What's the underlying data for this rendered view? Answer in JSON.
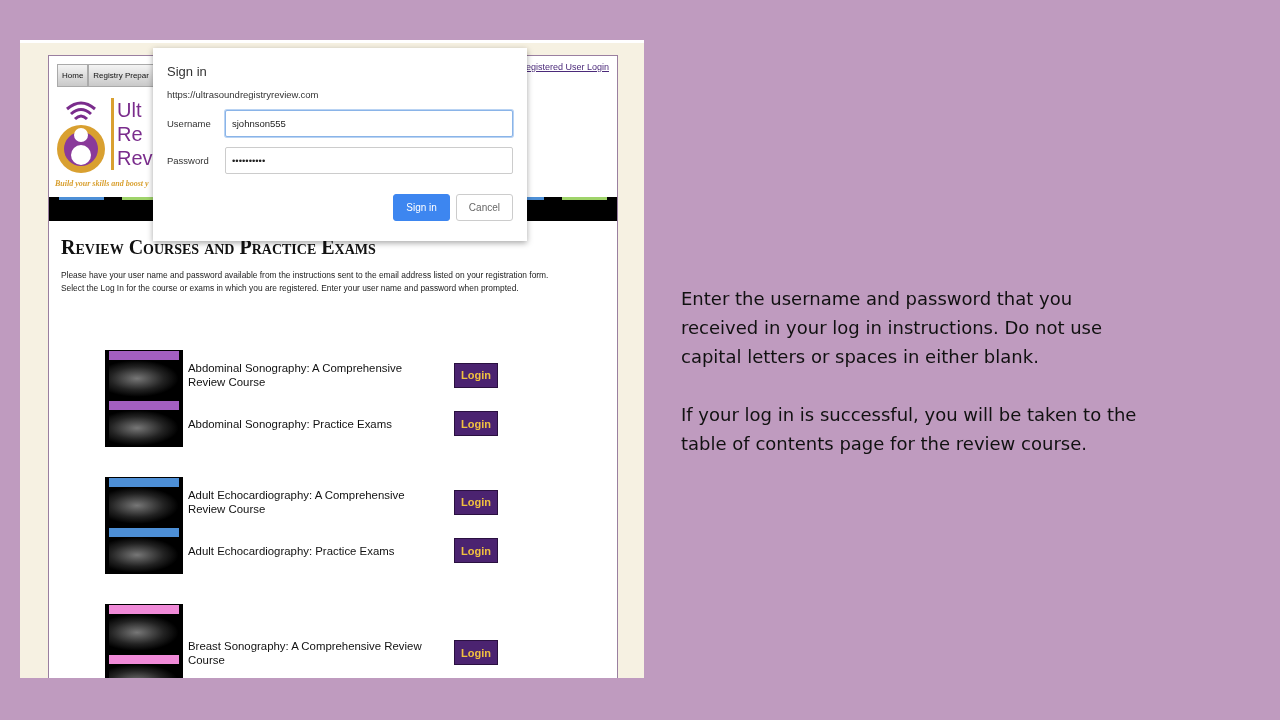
{
  "browser_page": {
    "nav": [
      {
        "label": "Home"
      },
      {
        "label": "Registry Prepar"
      }
    ],
    "top_link": "egistered User Login",
    "logo_lines": [
      "Ult",
      "Re",
      "Rev"
    ],
    "tagline": "Build your skills and boost y",
    "heading": "Review Courses and Practice Exams",
    "intro": [
      "Please have your user name and password available from the instructions sent to the email address listed on your registration form.",
      "Select the Log In for the course or exams in which you are registered.  Enter your user name and password when prompted."
    ],
    "course_groups": [
      {
        "color": "#a35fc0",
        "courses": [
          {
            "title": "Abdominal Sonography: A Comprehensive Review Course",
            "button": "Login"
          },
          {
            "title": "Abdominal Sonography: Practice Exams",
            "button": "Login"
          }
        ]
      },
      {
        "color": "#4d8fd6",
        "courses": [
          {
            "title": "Adult Echocardiography: A Comprehensive Review Course",
            "button": "Login"
          },
          {
            "title": "Adult Echocardiography: Practice Exams",
            "button": "Login"
          }
        ]
      },
      {
        "color": "#f08ad8",
        "courses": [
          {
            "title": "Breast Sonography: A Comprehensive Review Course",
            "button": "Login"
          }
        ]
      }
    ]
  },
  "dialog": {
    "title": "Sign in",
    "origin": "https://ultrasoundregistryreview.com",
    "fields": [
      {
        "label": "Username",
        "value": "sjohnson555",
        "focused": true
      },
      {
        "label": "Password",
        "value": "••••••••••",
        "focused": false
      }
    ],
    "buttons": [
      {
        "label": "Sign in",
        "kind": "primary"
      },
      {
        "label": "Cancel",
        "kind": "secondary"
      }
    ]
  },
  "slide_text": [
    "Enter the username and password that you received in your log in instructions. Do not use capital letters or spaces in either blank.",
    "If your log in is successful, you will be taken to the table of contents page for the review course."
  ]
}
